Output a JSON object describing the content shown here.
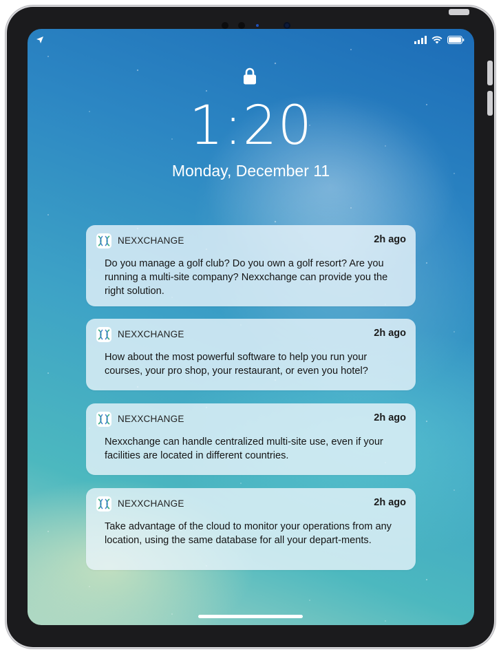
{
  "lock_screen": {
    "time": "1:20",
    "date": "Monday, December 11"
  },
  "status_bar": {
    "icons": [
      "location-arrow-icon",
      "signal-bars-icon",
      "wifi-icon",
      "battery-icon"
    ]
  },
  "notifications": [
    {
      "app": "NEXXCHANGE",
      "time": "2h ago",
      "body": "Do you manage a golf club? Do you own a golf resort? Are you running a multi-site company? Nexxchange can provide you the right solution."
    },
    {
      "app": "NEXXCHANGE",
      "time": "2h ago",
      "body": "How about the most powerful software to help you run your courses, your pro shop, your restaurant, or even you hotel?"
    },
    {
      "app": "NEXXCHANGE",
      "time": "2h ago",
      "body": "Nexxchange can handle centralized multi-site use, even if your facilities are located in different countries."
    },
    {
      "app": "NEXXCHANGE",
      "time": "2h ago",
      "body": "Take advantage of the cloud to monitor your operations from any location, using the same database for all your depart-ments."
    }
  ],
  "colors": {
    "app_icon_green": "#3fae85",
    "app_icon_blue": "#3b7fc7"
  }
}
